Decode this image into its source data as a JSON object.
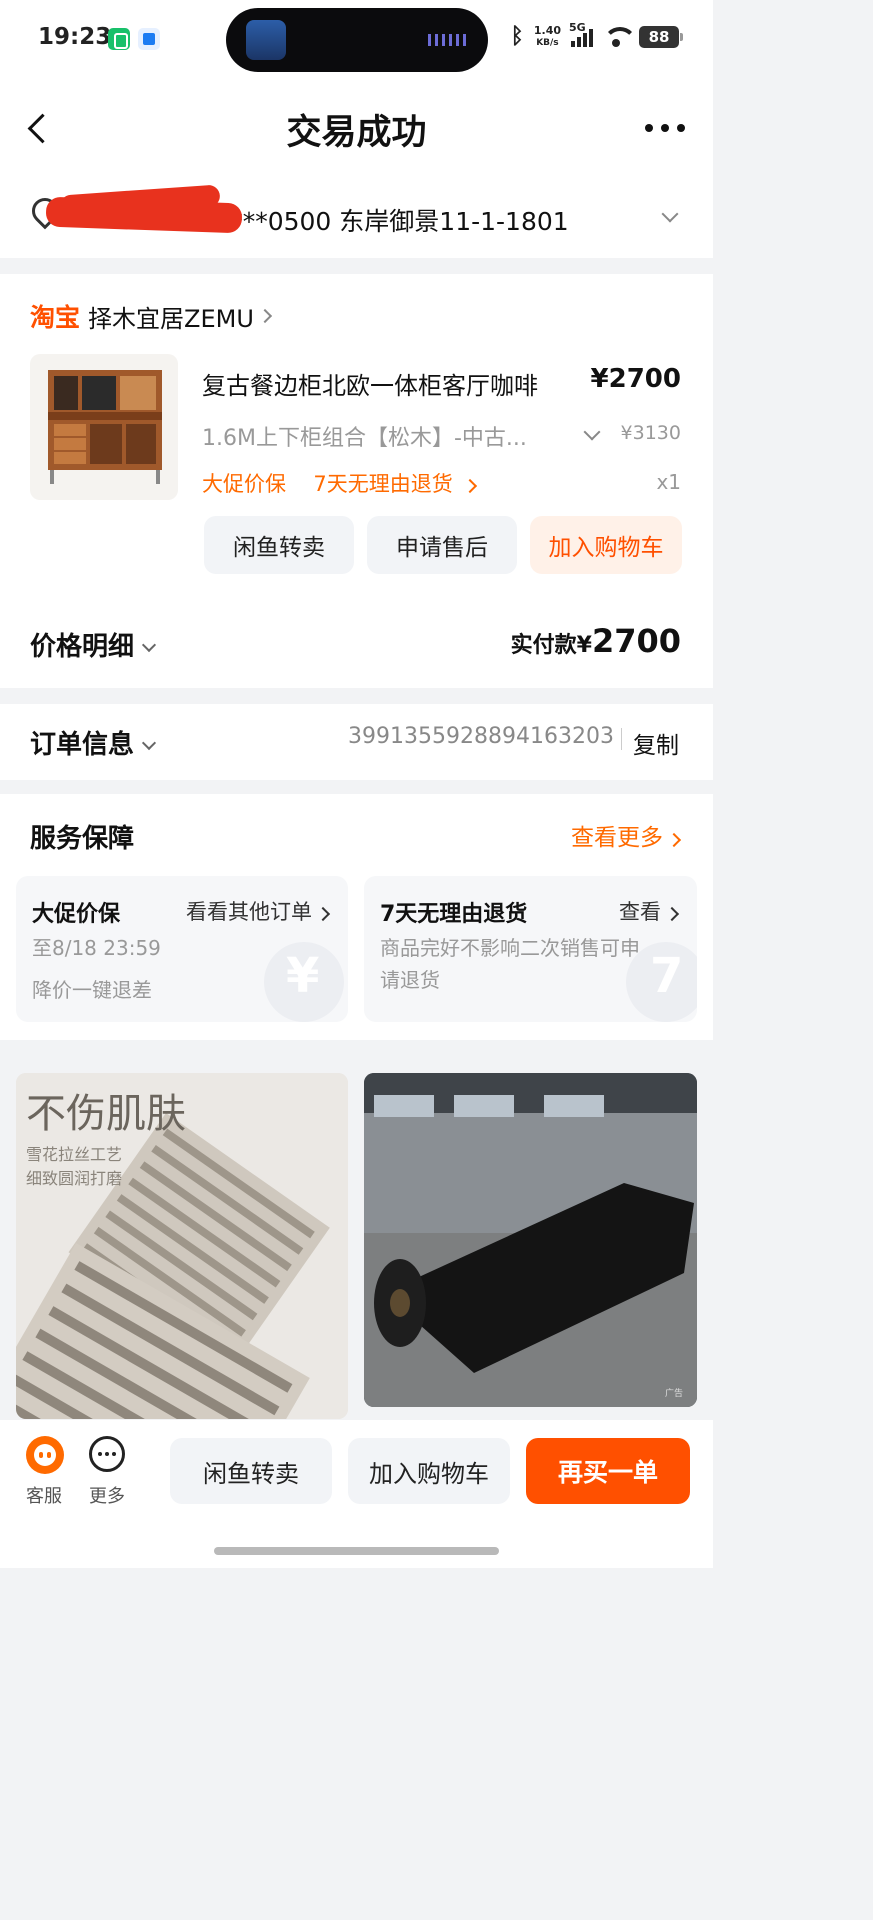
{
  "status_bar": {
    "time": "19:23",
    "net_speed_value": "1.40",
    "net_speed_unit": "KB/s",
    "network": "5G",
    "battery": "88"
  },
  "header": {
    "title": "交易成功"
  },
  "address": {
    "text": "152****0500  东岸御景11-1-1801"
  },
  "order": {
    "platform": "淘宝",
    "shop_name": "择木宜居ZEMU",
    "product_title": "复古餐边柜北欧一体柜客厅咖啡",
    "price": "¥2700",
    "sku": "1.6M上下柜组合【松木】-中古...",
    "original_price": "¥3130",
    "tag_promo": "大促价保",
    "tag_return": "7天无理由退货",
    "quantity": "x1",
    "buttons": {
      "resell": "闲鱼转卖",
      "after_sale": "申请售后",
      "add_cart": "加入购物车"
    }
  },
  "price_detail": {
    "label": "价格明细",
    "paid_label": "实付款¥",
    "paid_amount": "2700"
  },
  "order_info": {
    "label": "订单信息",
    "order_number": "3991355928894163203",
    "copy_label": "复制"
  },
  "service": {
    "title": "服务保障",
    "see_more": "查看更多",
    "cards": [
      {
        "title": "大促价保",
        "link": "看看其他订单",
        "lines": [
          "至8/18 23:59",
          "降价一键退差"
        ],
        "watermark": "¥"
      },
      {
        "title": "7天无理由退货",
        "link": "查看",
        "lines": [
          "商品完好不影响二次销售可申",
          "请退货"
        ],
        "watermark": "7"
      }
    ]
  },
  "recommendations": [
    {
      "headline": "不伤肌肤",
      "sub1": "雪花拉丝工艺",
      "sub2": "细致圆润打磨"
    },
    {
      "ad_label": "广告"
    }
  ],
  "bottom_bar": {
    "customer_service": "客服",
    "more": "更多",
    "resell": "闲鱼转卖",
    "add_cart": "加入购物车",
    "buy_again": "再买一单"
  },
  "colors": {
    "accent": "#ff5000",
    "accent_light": "#fff1e8",
    "tag_orange": "#ff6a00",
    "text_grey": "#999999",
    "background": "#f2f3f5"
  }
}
